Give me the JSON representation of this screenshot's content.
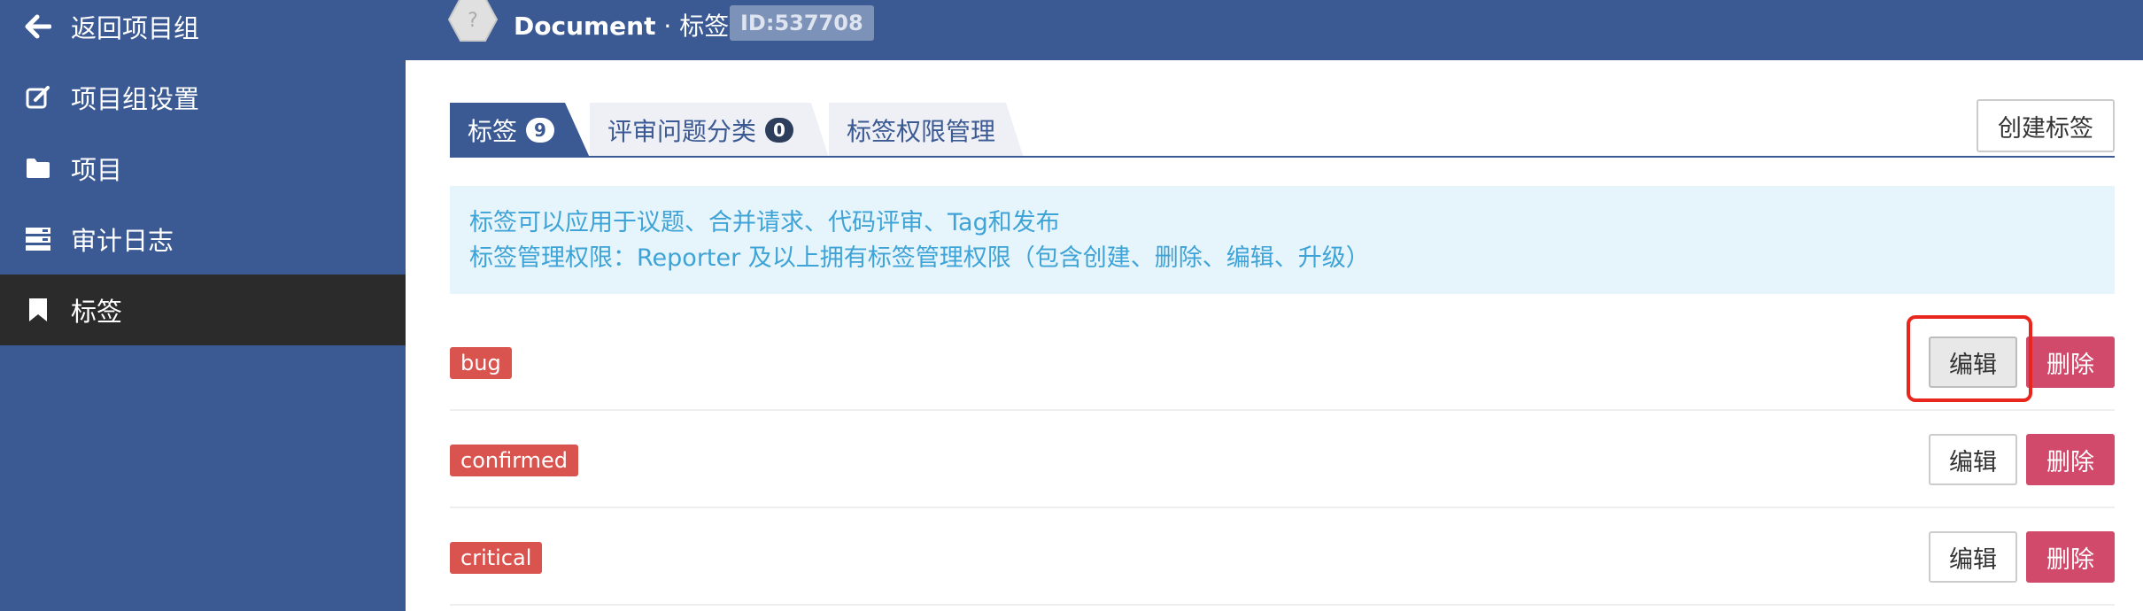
{
  "sidebar": {
    "items": [
      {
        "label": "返回项目组",
        "icon": "arrow-left-icon"
      },
      {
        "label": "项目组设置",
        "icon": "edit-icon"
      },
      {
        "label": "项目",
        "icon": "folder-icon"
      },
      {
        "label": "审计日志",
        "icon": "server-icon"
      },
      {
        "label": "标签",
        "icon": "bookmark-icon",
        "active": true
      }
    ]
  },
  "header": {
    "title": "Document",
    "subtitle": " · 标签",
    "id_badge": "ID:537708",
    "avatar_icon": "hexagon-avatar-icon"
  },
  "tabs": [
    {
      "label": "标签",
      "count": "9",
      "active": true
    },
    {
      "label": "评审问题分类",
      "count": "0"
    },
    {
      "label": "标签权限管理"
    }
  ],
  "create_button": "创建标签",
  "info": {
    "line1": "标签可以应用于议题、合并请求、代码评审、Tag和发布",
    "line2": "标签管理权限：Reporter 及以上拥有标签管理权限（包含创建、删除、编辑、升级）"
  },
  "labels": [
    {
      "name": "bug",
      "edit": "编辑",
      "delete": "删除"
    },
    {
      "name": "confirmed",
      "edit": "编辑",
      "delete": "删除"
    },
    {
      "name": "critical",
      "edit": "编辑",
      "delete": "删除"
    }
  ],
  "colors": {
    "primary": "#3b5a93",
    "sidebar_active": "#2b2b2b",
    "label_red": "#d9534f",
    "delete_pink": "#d24a6b",
    "info_bg": "#e6f4fb",
    "info_text": "#3ea3d6",
    "highlight": "#e8261d"
  }
}
